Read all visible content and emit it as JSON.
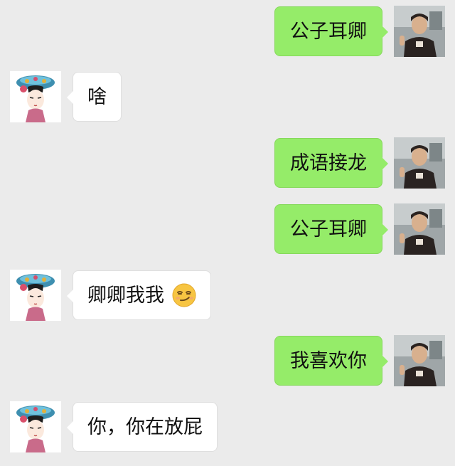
{
  "messages": [
    {
      "side": "right",
      "text": "公子耳卿"
    },
    {
      "side": "left",
      "text": "啥"
    },
    {
      "side": "right",
      "text": "成语接龙"
    },
    {
      "side": "right",
      "text": "公子耳卿"
    },
    {
      "side": "left",
      "text": "卿卿我我",
      "emoji": "smirking-face"
    },
    {
      "side": "right",
      "text": "我喜欢你"
    },
    {
      "side": "left",
      "text": "你，你在放屁"
    }
  ],
  "colors": {
    "background": "#ebebeb",
    "sent_bubble": "#95ec69",
    "received_bubble": "#ffffff"
  },
  "icons": {
    "sender_avatar": "boy-photo-avatar",
    "receiver_avatar": "cartoon-girl-avatar",
    "emoji": "smirking-face"
  }
}
